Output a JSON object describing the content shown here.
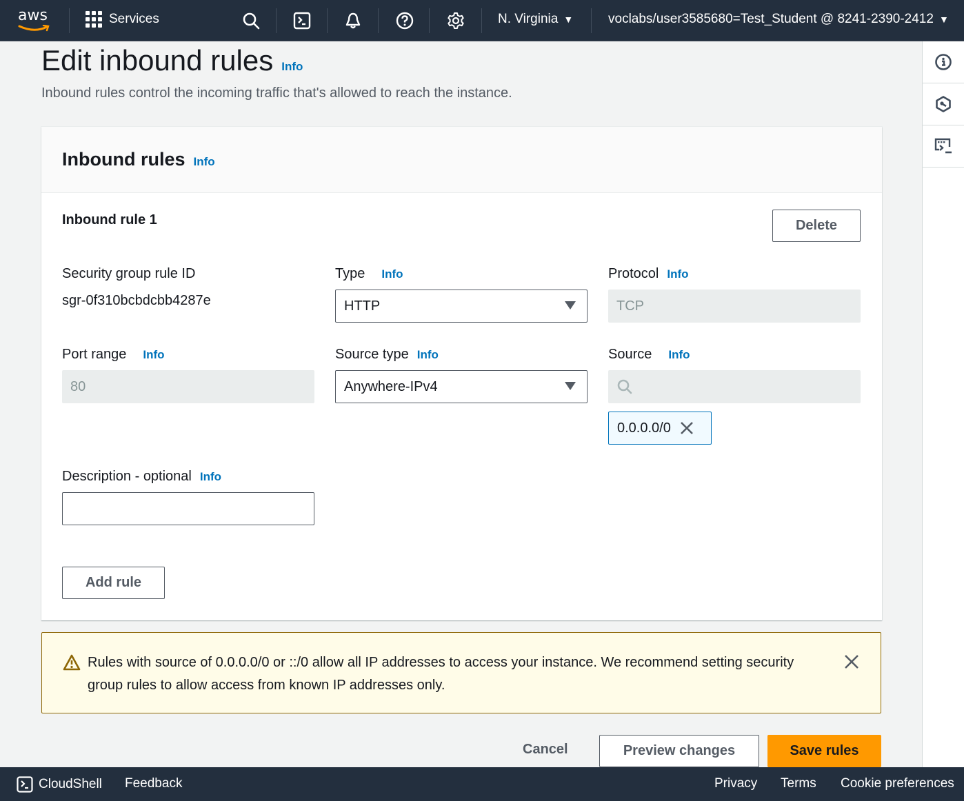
{
  "topnav": {
    "logo_text": "aws",
    "services_label": "Services",
    "icons": [
      "search-icon",
      "cloudshell-icon",
      "notifications-icon",
      "help-icon",
      "settings-icon"
    ],
    "region": "N. Virginia",
    "account": "voclabs/user3585680=Test_Student @ 8241-2390-2412"
  },
  "rail": {
    "icons": [
      "info-icon",
      "cloud-objects-icon",
      "screen-share-icon"
    ]
  },
  "page": {
    "title": "Edit inbound rules",
    "title_info": "Info",
    "description": "Inbound rules control the incoming traffic that's allowed to reach the instance."
  },
  "panel": {
    "title": "Inbound rules",
    "title_info": "Info",
    "rule": {
      "title": "Inbound rule 1",
      "delete_label": "Delete",
      "sg_rule_id_label": "Security group rule ID",
      "sg_rule_id_value": "sgr-0f310bcbdcbb4287e",
      "type_label": "Type",
      "type_info": "Info",
      "type_value": "HTTP",
      "protocol_label": "Protocol",
      "protocol_info": "Info",
      "protocol_value": "TCP",
      "port_range_label": "Port range",
      "port_range_info": "Info",
      "port_range_value": "80",
      "source_type_label": "Source type",
      "source_type_info": "Info",
      "source_type_value": "Anywhere-IPv4",
      "source_label": "Source",
      "source_info": "Info",
      "source_search_value": "",
      "source_token": "0.0.0.0/0",
      "description_label": "Description - optional",
      "description_info": "Info",
      "description_value": ""
    },
    "add_rule_label": "Add rule"
  },
  "alert": {
    "type": "warning",
    "text": "Rules with source of 0.0.0.0/0 or ::/0 allow all IP addresses to access your instance. We recommend setting security group rules to allow access from known IP addresses only."
  },
  "actions": {
    "cancel_label": "Cancel",
    "preview_label": "Preview changes",
    "save_label": "Save rules"
  },
  "footer": {
    "cloudshell_label": "CloudShell",
    "feedback_label": "Feedback",
    "privacy_label": "Privacy",
    "terms_label": "Terms",
    "cookie_label": "Cookie preferences"
  },
  "colors": {
    "nav_bg": "#232f3e",
    "link": "#0073bb",
    "primary": "#ff9900",
    "warning_bg": "#fffce8",
    "warning_border": "#8d6605"
  }
}
